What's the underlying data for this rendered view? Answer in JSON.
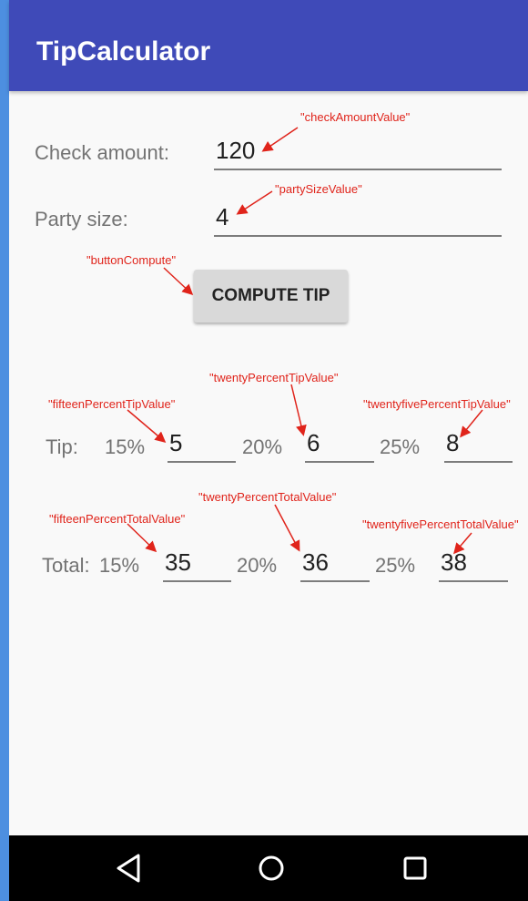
{
  "app_bar": {
    "title": "TipCalculator"
  },
  "form": {
    "check_amount_label": "Check amount:",
    "check_amount_value": "120",
    "party_size_label": "Party size:",
    "party_size_value": "4",
    "compute_button_label": "COMPUTE TIP"
  },
  "tip_row": {
    "label": "Tip:",
    "pct_15": "15%",
    "value_15": "5",
    "pct_20": "20%",
    "value_20": "6",
    "pct_25": "25%",
    "value_25": "8"
  },
  "total_row": {
    "label": "Total:",
    "pct_15": "15%",
    "value_15": "35",
    "pct_20": "20%",
    "value_20": "36",
    "pct_25": "25%",
    "value_25": "38"
  },
  "annotations": {
    "check_amount": "\"checkAmountValue\"",
    "party_size": "\"partySizeValue\"",
    "button_compute": "\"buttonCompute\"",
    "fifteen_tip": "\"fifteenPercentTipValue\"",
    "twenty_tip": "\"twentyPercentTipValue\"",
    "twentyfive_tip": "\"twentyfivePercentTipValue\"",
    "fifteen_total": "\"fifteenPercentTotalValue\"",
    "twenty_total": "\"twentyPercentTotalValue\"",
    "twentyfive_total": "\"twentyfivePercentTotalValue\""
  },
  "colors": {
    "app_bar": "#3f4ab8",
    "annotation": "#e0241b",
    "nav_bar": "#000000"
  },
  "nav": {
    "back_icon": "back-triangle-icon",
    "home_icon": "home-circle-icon",
    "recents_icon": "recents-square-icon"
  }
}
